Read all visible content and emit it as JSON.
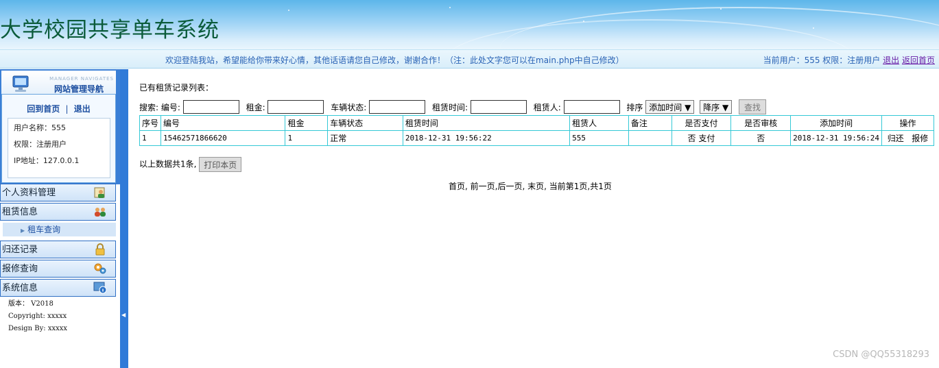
{
  "header": {
    "title": "大学校园共享单车系统",
    "welcome": "欢迎登陆我站，希望能给你带来好心情，其他话语请您自己修改，谢谢合作！（注：此处文字您可以在main.php中自己修改）",
    "current_user_text": "当前用户：555 权限：注册用户",
    "logout": "退出",
    "back_home": "返回首页"
  },
  "sidebar": {
    "logo_en": "MANAGER NAVIGATES",
    "logo_cn": "网站管理导航",
    "home_link": "回到首页",
    "separator": "|",
    "logout_link": "退出",
    "info": {
      "username": "用户名称：555",
      "role": "权限：注册用户",
      "ip": "IP地址：127.0.0.1"
    },
    "menu": [
      {
        "label": "个人资料管理",
        "icon": "user-profile-icon"
      },
      {
        "label": "租赁信息",
        "icon": "users-group-icon"
      },
      {
        "label": "归还记录",
        "icon": "lock-icon"
      },
      {
        "label": "报修查询",
        "icon": "gears-icon"
      },
      {
        "label": "系统信息",
        "icon": "system-info-icon"
      }
    ],
    "submenu": {
      "label": "租车查询"
    },
    "footer": {
      "version": "版本： V2018",
      "copyright": "Copyright: xxxxx",
      "design": "Design By:  xxxxx"
    }
  },
  "main": {
    "list_title": "已有租赁记录列表：",
    "search": {
      "label": "搜索:",
      "fields": [
        "编号:",
        "租金:",
        "车辆状态:",
        "租赁时间:",
        "租赁人:"
      ],
      "sort_label": "排序",
      "sort_field": "添加时间",
      "sort_order": "降序",
      "button": "查找"
    },
    "table": {
      "headers": [
        "序号",
        "编号",
        "租金",
        "车辆状态",
        "租赁时间",
        "租赁人",
        "备注",
        "是否支付",
        "是否审核",
        "添加时间",
        "操作"
      ],
      "rows": [
        {
          "index": "1",
          "code": "15462571866620",
          "rent": "1",
          "status": "正常",
          "rent_time": "2018-12-31 19:56:22",
          "renter": "555",
          "remark": "",
          "paid": "否",
          "pay_link": "支付",
          "audited": "否",
          "added_time": "2018-12-31 19:56:24",
          "return_link": "归还",
          "repair_link": "报修"
        }
      ]
    },
    "summary": "以上数据共1条,",
    "print_button": "打印本页",
    "pager": {
      "first": "首页,",
      "prev": "前一页",
      "next": ",后一页,",
      "last": "末页,",
      "current": "当前第1页,共1页"
    }
  },
  "watermark": "CSDN @QQ55318293"
}
